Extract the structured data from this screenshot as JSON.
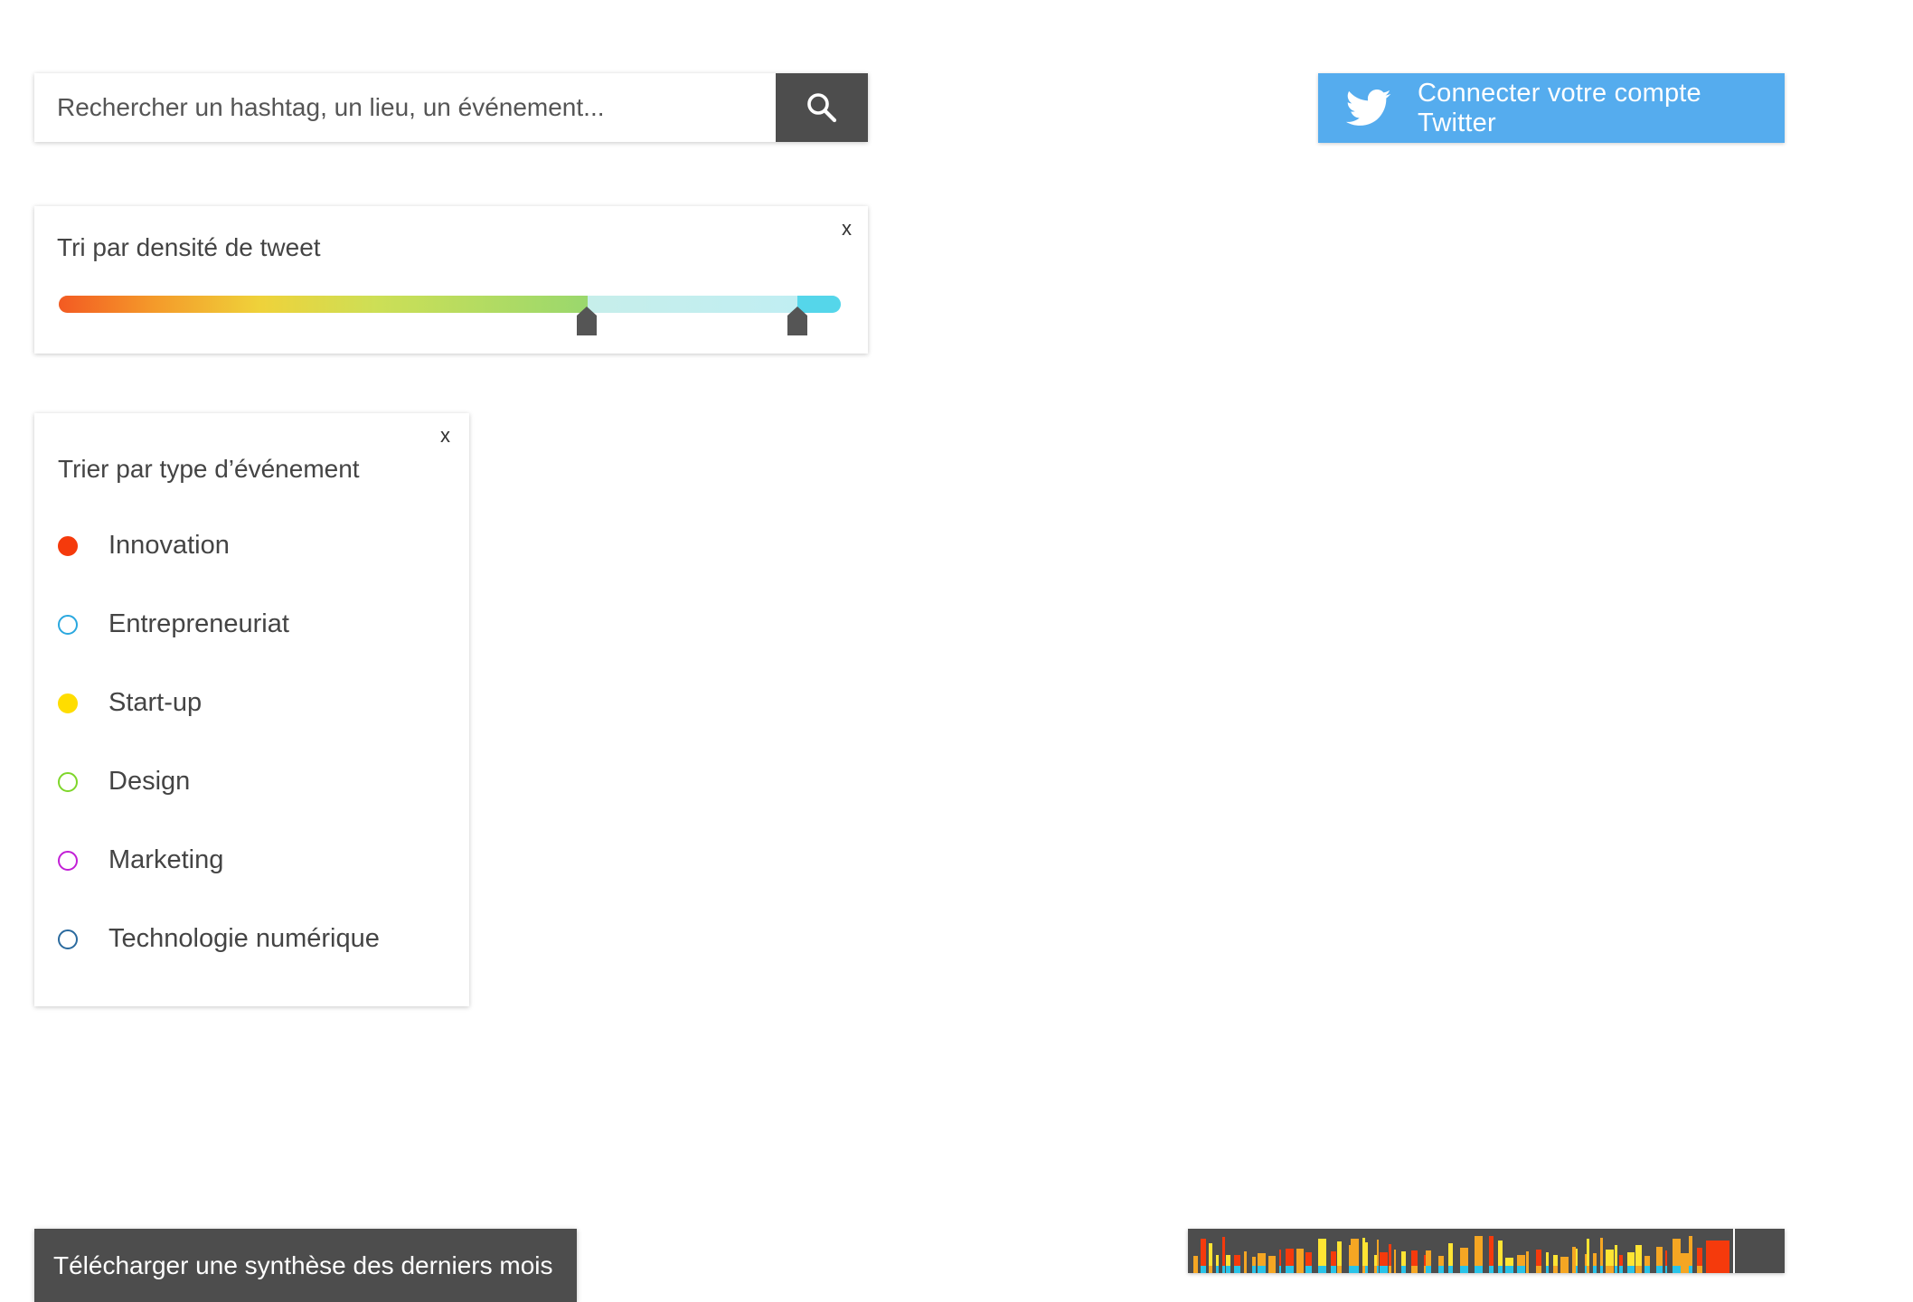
{
  "search": {
    "placeholder": "Rechercher un hashtag, un lieu, un événement...",
    "value": "",
    "icon": "search-icon"
  },
  "twitter": {
    "label": "Connecter votre compte Twitter",
    "icon": "twitter-bird-icon",
    "color": "#55acee"
  },
  "density_filter": {
    "title": "Tri par densité de tweet",
    "close": "x",
    "range_low": 0.676,
    "range_high": 0.944
  },
  "type_filter": {
    "title": "Trier par type d’événement",
    "close": "x",
    "items": [
      {
        "label": "Innovation",
        "color": "#f53a0c",
        "selected": true
      },
      {
        "label": "Entrepreneuriat",
        "color": "#2aa8df",
        "selected": false
      },
      {
        "label": "Start-up",
        "color": "#ffdd00",
        "selected": true
      },
      {
        "label": "Design",
        "color": "#7ed62a",
        "selected": false
      },
      {
        "label": "Marketing",
        "color": "#c21fd6",
        "selected": false
      },
      {
        "label": "Technologie numérique",
        "color": "#2a6a9e",
        "selected": false
      }
    ]
  },
  "download": {
    "label": "Télécharger une synthèse des derniers mois"
  },
  "timeline": {
    "selection_end": 0.914,
    "colors": [
      "#f53a0c",
      "#f5a623",
      "#ffe433",
      "#29c3e8"
    ]
  }
}
